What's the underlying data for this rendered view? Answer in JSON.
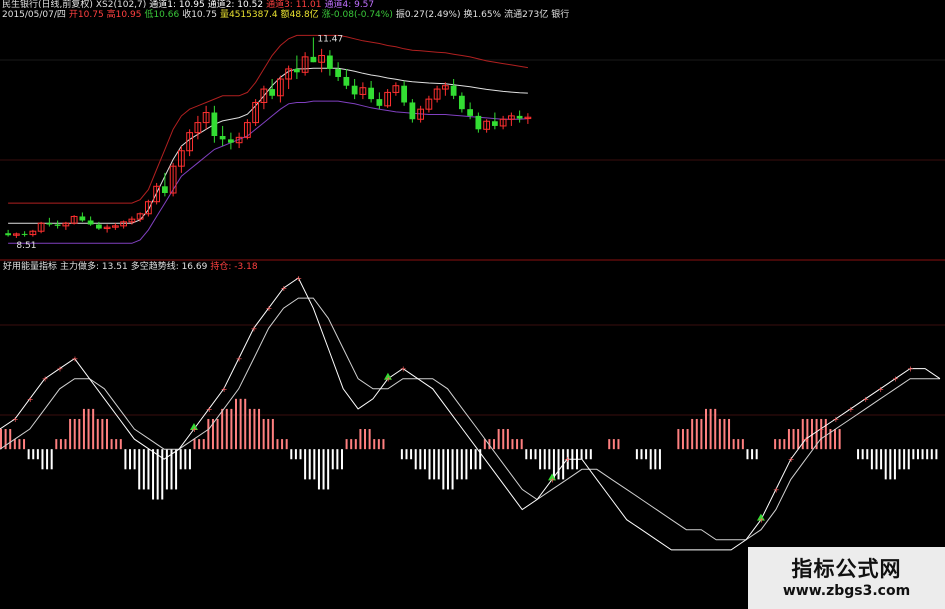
{
  "header": {
    "line1": [
      {
        "text": "民生银行(日线,前复权)",
        "color": "#e0e0e0"
      },
      {
        "text": "XS2(102,7)",
        "color": "#e0e0e0"
      },
      {
        "text": "通道1: 10.95",
        "color": "#ffffff"
      },
      {
        "text": "通道2: 10.52",
        "color": "#ffffff"
      },
      {
        "text": "通道3: 11.01",
        "color": "#ff4040"
      },
      {
        "text": "通道4: 9.57",
        "color": "#c070ff"
      }
    ],
    "line2": [
      {
        "text": "2015/05/07/四",
        "color": "#e0e0e0"
      },
      {
        "text": "开10.75",
        "color": "#ff4040"
      },
      {
        "text": "高10.95",
        "color": "#ff4040"
      },
      {
        "text": "低10.66",
        "color": "#3ac83a"
      },
      {
        "text": "收10.75",
        "color": "#e0e0e0"
      },
      {
        "text": "量4515387.4",
        "color": "#e8e030"
      },
      {
        "text": "额48.8亿",
        "color": "#e8e030"
      },
      {
        "text": "涨-0.08(-0.74%)",
        "color": "#3ac83a"
      },
      {
        "text": "振0.27(2.49%)",
        "color": "#e0e0e0"
      },
      {
        "text": "换1.65%",
        "color": "#e0e0e0"
      },
      {
        "text": "流通273亿",
        "color": "#e0e0e0"
      },
      {
        "text": "银行",
        "color": "#e0e0e0"
      }
    ],
    "price_high_label": "11.47",
    "price_low_label": "8.51"
  },
  "indicator": {
    "labels": [
      {
        "text": "好用能量指标",
        "color": "#e0e0e0"
      },
      {
        "text": "主力做多: 13.51",
        "color": "#e0e0e0"
      },
      {
        "text": "多空趋势线: 16.69",
        "color": "#e0e0e0"
      },
      {
        "text": "持仓: -3.18",
        "color": "#ff4040"
      }
    ]
  },
  "colors": {
    "background": "#000000",
    "up_candle": "#ff3030",
    "down_candle": "#33dd33",
    "upper_channel": "#b02020",
    "lower_channel": "#8040c0",
    "midline": "#e0e0e0",
    "positive_bar": "#ff8080",
    "negative_bar": "#ffffff",
    "divider": "#8a1010"
  },
  "chart_data": {
    "type": "candlestick+indicator",
    "price_ylim": [
      8.3,
      11.7
    ],
    "candles": [
      [
        8.55,
        8.6,
        8.5,
        8.52
      ],
      [
        8.52,
        8.56,
        8.48,
        8.54
      ],
      [
        8.54,
        8.58,
        8.5,
        8.53
      ],
      [
        8.53,
        8.6,
        8.5,
        8.58
      ],
      [
        8.58,
        8.72,
        8.55,
        8.7
      ],
      [
        8.7,
        8.78,
        8.65,
        8.68
      ],
      [
        8.68,
        8.74,
        8.62,
        8.66
      ],
      [
        8.66,
        8.72,
        8.6,
        8.7
      ],
      [
        8.7,
        8.82,
        8.68,
        8.8
      ],
      [
        8.8,
        8.86,
        8.72,
        8.74
      ],
      [
        8.74,
        8.8,
        8.66,
        8.68
      ],
      [
        8.68,
        8.72,
        8.6,
        8.62
      ],
      [
        8.62,
        8.68,
        8.56,
        8.64
      ],
      [
        8.64,
        8.7,
        8.6,
        8.66
      ],
      [
        8.66,
        8.74,
        8.62,
        8.72
      ],
      [
        8.72,
        8.8,
        8.68,
        8.76
      ],
      [
        8.76,
        8.86,
        8.72,
        8.84
      ],
      [
        8.84,
        9.05,
        8.8,
        9.02
      ],
      [
        9.02,
        9.3,
        8.98,
        9.25
      ],
      [
        9.25,
        9.45,
        9.1,
        9.15
      ],
      [
        9.15,
        9.6,
        9.1,
        9.55
      ],
      [
        9.55,
        9.85,
        9.45,
        9.78
      ],
      [
        9.78,
        10.1,
        9.7,
        10.05
      ],
      [
        10.05,
        10.3,
        9.95,
        10.2
      ],
      [
        10.2,
        10.45,
        10.1,
        10.35
      ],
      [
        10.35,
        10.45,
        9.9,
        10.0
      ],
      [
        10.0,
        10.15,
        9.85,
        9.95
      ],
      [
        9.95,
        10.05,
        9.8,
        9.9
      ],
      [
        9.9,
        10.05,
        9.82,
        9.98
      ],
      [
        9.98,
        10.25,
        9.95,
        10.2
      ],
      [
        10.2,
        10.55,
        10.15,
        10.5
      ],
      [
        10.5,
        10.75,
        10.4,
        10.7
      ],
      [
        10.7,
        10.85,
        10.55,
        10.6
      ],
      [
        10.6,
        10.9,
        10.5,
        10.85
      ],
      [
        10.85,
        11.05,
        10.7,
        11.0
      ],
      [
        11.0,
        11.2,
        10.85,
        10.95
      ],
      [
        10.95,
        11.25,
        10.9,
        11.18
      ],
      [
        11.18,
        11.47,
        11.1,
        11.1
      ],
      [
        11.1,
        11.3,
        10.95,
        11.2
      ],
      [
        11.2,
        11.28,
        10.9,
        11.0
      ],
      [
        11.0,
        11.1,
        10.82,
        10.88
      ],
      [
        10.88,
        11.0,
        10.7,
        10.75
      ],
      [
        10.75,
        10.85,
        10.55,
        10.62
      ],
      [
        10.62,
        10.8,
        10.55,
        10.72
      ],
      [
        10.72,
        10.82,
        10.5,
        10.55
      ],
      [
        10.55,
        10.65,
        10.4,
        10.45
      ],
      [
        10.45,
        10.7,
        10.42,
        10.65
      ],
      [
        10.65,
        10.8,
        10.6,
        10.75
      ],
      [
        10.75,
        10.82,
        10.45,
        10.5
      ],
      [
        10.5,
        10.55,
        10.2,
        10.25
      ],
      [
        10.25,
        10.45,
        10.2,
        10.4
      ],
      [
        10.4,
        10.6,
        10.35,
        10.55
      ],
      [
        10.55,
        10.75,
        10.5,
        10.7
      ],
      [
        10.7,
        10.8,
        10.6,
        10.75
      ],
      [
        10.75,
        10.85,
        10.55,
        10.6
      ],
      [
        10.6,
        10.65,
        10.35,
        10.4
      ],
      [
        10.4,
        10.5,
        10.25,
        10.3
      ],
      [
        10.3,
        10.35,
        10.05,
        10.1
      ],
      [
        10.1,
        10.25,
        10.05,
        10.22
      ],
      [
        10.22,
        10.35,
        10.1,
        10.15
      ],
      [
        10.15,
        10.3,
        10.1,
        10.25
      ],
      [
        10.25,
        10.35,
        10.15,
        10.3
      ],
      [
        10.3,
        10.38,
        10.2,
        10.26
      ],
      [
        10.26,
        10.34,
        10.18,
        10.28
      ]
    ],
    "upper_channel": [
      9.0,
      9.0,
      9.0,
      9.0,
      9.0,
      9.0,
      9.0,
      9.0,
      9.0,
      9.0,
      9.0,
      9.0,
      9.0,
      9.0,
      9.0,
      9.0,
      9.05,
      9.2,
      9.5,
      9.8,
      10.1,
      10.3,
      10.4,
      10.45,
      10.5,
      10.55,
      10.6,
      10.6,
      10.6,
      10.65,
      10.8,
      11.0,
      11.2,
      11.35,
      11.45,
      11.5,
      11.5,
      11.5,
      11.5,
      11.5,
      11.5,
      11.48,
      11.45,
      11.42,
      11.4,
      11.38,
      11.35,
      11.33,
      11.3,
      11.28,
      11.27,
      11.26,
      11.25,
      11.24,
      11.22,
      11.2,
      11.18,
      11.15,
      11.12,
      11.1,
      11.08,
      11.06,
      11.04,
      11.02
    ],
    "lower_channel": [
      8.4,
      8.4,
      8.4,
      8.4,
      8.4,
      8.4,
      8.4,
      8.4,
      8.4,
      8.4,
      8.4,
      8.4,
      8.4,
      8.4,
      8.4,
      8.4,
      8.45,
      8.6,
      8.8,
      9.0,
      9.2,
      9.4,
      9.5,
      9.6,
      9.7,
      9.8,
      9.85,
      9.9,
      9.95,
      10.0,
      10.1,
      10.2,
      10.3,
      10.4,
      10.48,
      10.5,
      10.5,
      10.52,
      10.52,
      10.52,
      10.52,
      10.5,
      10.48,
      10.45,
      10.42,
      10.4,
      10.38,
      10.36,
      10.35,
      10.34,
      10.33,
      10.32,
      10.32,
      10.32,
      10.31,
      10.3,
      10.29,
      10.28,
      10.27,
      10.26,
      10.25,
      10.25,
      10.25,
      10.26
    ],
    "ind_ylim": [
      -12,
      17
    ],
    "main_line": [
      2,
      3,
      5,
      7,
      8,
      9,
      7,
      5,
      3,
      1,
      0,
      -1,
      0,
      2,
      4,
      6,
      9,
      12,
      14,
      16,
      17,
      14,
      10,
      6,
      4,
      5,
      7,
      8,
      7,
      6,
      4,
      2,
      0,
      -2,
      -4,
      -6,
      -5,
      -3,
      -1,
      -1,
      -3,
      -5,
      -7,
      -8,
      -9,
      -10,
      -10,
      -10,
      -10,
      -10,
      -9,
      -7,
      -4,
      -1,
      1,
      2,
      3,
      4,
      5,
      6,
      7,
      8,
      8,
      7
    ],
    "trend_line": [
      0,
      1,
      2,
      4,
      6,
      7,
      7,
      6,
      4,
      2,
      1,
      0,
      0,
      1,
      2,
      4,
      6,
      9,
      12,
      14,
      15,
      15,
      13,
      10,
      7,
      6,
      6,
      7,
      7,
      7,
      6,
      4,
      2,
      0,
      -2,
      -4,
      -5,
      -4,
      -3,
      -2,
      -2,
      -3,
      -4,
      -5,
      -6,
      -7,
      -8,
      -8,
      -9,
      -9,
      -9,
      -8,
      -6,
      -3,
      -1,
      1,
      2,
      3,
      4,
      5,
      6,
      7,
      7,
      7
    ],
    "histogram": [
      2,
      1,
      -1,
      -2,
      1,
      3,
      4,
      3,
      1,
      -2,
      -4,
      -5,
      -4,
      -2,
      1,
      3,
      4,
      5,
      4,
      3,
      1,
      -1,
      -3,
      -4,
      -2,
      1,
      2,
      1,
      0,
      -1,
      -2,
      -3,
      -4,
      -3,
      -2,
      1,
      2,
      1,
      -1,
      -2,
      -3,
      -2,
      -1,
      0,
      1,
      0,
      -1,
      -2,
      0,
      2,
      3,
      4,
      3,
      1,
      -1,
      0,
      1,
      2,
      3,
      3,
      2,
      0,
      -1,
      -2,
      -3,
      -2,
      -1,
      -1
    ]
  }
}
